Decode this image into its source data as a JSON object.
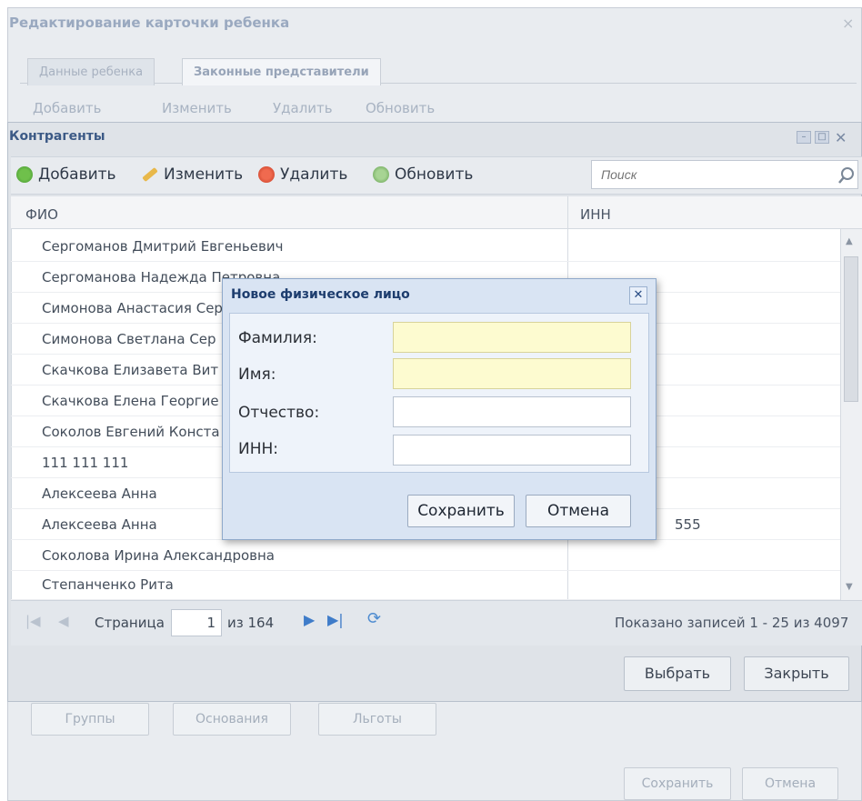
{
  "background_window": {
    "title": "Редактирование карточки ребенка",
    "close_glyph": "×",
    "tabs": [
      "Данные ребенка",
      "Законные представители"
    ],
    "toolbar": {
      "add": "Добавить",
      "edit": "Изменить",
      "delete": "Удалить",
      "refresh": "Обновить"
    },
    "bottom_tabs": [
      "Группы",
      "Основания",
      "Льготы"
    ],
    "save_label": "Сохранить",
    "cancel_label": "Отмена"
  },
  "contractors_window": {
    "title": "Контрагенты",
    "toolbar": {
      "add": "Добавить",
      "edit": "Изменить",
      "delete": "Удалить",
      "refresh": "Обновить"
    },
    "search_placeholder": "Поиск",
    "columns": {
      "fio": "ФИО",
      "inn": "ИНН"
    },
    "rows": [
      {
        "fio": "Сергоманов Дмитрий Евгеньевич",
        "inn": ""
      },
      {
        "fio": "Сергоманова Надежда Петровна",
        "inn": ""
      },
      {
        "fio": "Симонова Анастасия Сер",
        "inn": ""
      },
      {
        "fio": "Симонова Светлана Сер",
        "inn": ""
      },
      {
        "fio": "Скачкова Елизавета Вит",
        "inn": ""
      },
      {
        "fio": "Скачкова Елена Георгие",
        "inn": ""
      },
      {
        "fio": "Соколов Евгений Конста",
        "inn": ""
      },
      {
        "fio": "111 111 111",
        "inn": ""
      },
      {
        "fio": "Алексеева Анна",
        "inn": ""
      },
      {
        "fio": "Алексеева Анна",
        "inn": "555"
      },
      {
        "fio": "Соколова Ирина Александровна",
        "inn": ""
      },
      {
        "fio": "Степанченко Рита",
        "inn": ""
      }
    ],
    "pager": {
      "page_label": "Страница",
      "page_value": "1",
      "of_label": "из 164",
      "info": "Показано записей 1 - 25 из 4097"
    },
    "select_label": "Выбрать",
    "close_label": "Закрыть"
  },
  "dialog": {
    "title": "Новое физическое лицо",
    "fields": {
      "last_name": {
        "label": "Фамилия:",
        "value": ""
      },
      "first_name": {
        "label": "Имя:",
        "value": ""
      },
      "middle_name": {
        "label": "Отчество:",
        "value": ""
      },
      "inn": {
        "label": "ИНН:",
        "value": ""
      }
    },
    "save_label": "Сохранить",
    "cancel_label": "Отмена"
  },
  "colors": {
    "required_field": "#fdfbd0",
    "title_text": "#3c5a86",
    "link_blue": "#3f7cc9"
  }
}
